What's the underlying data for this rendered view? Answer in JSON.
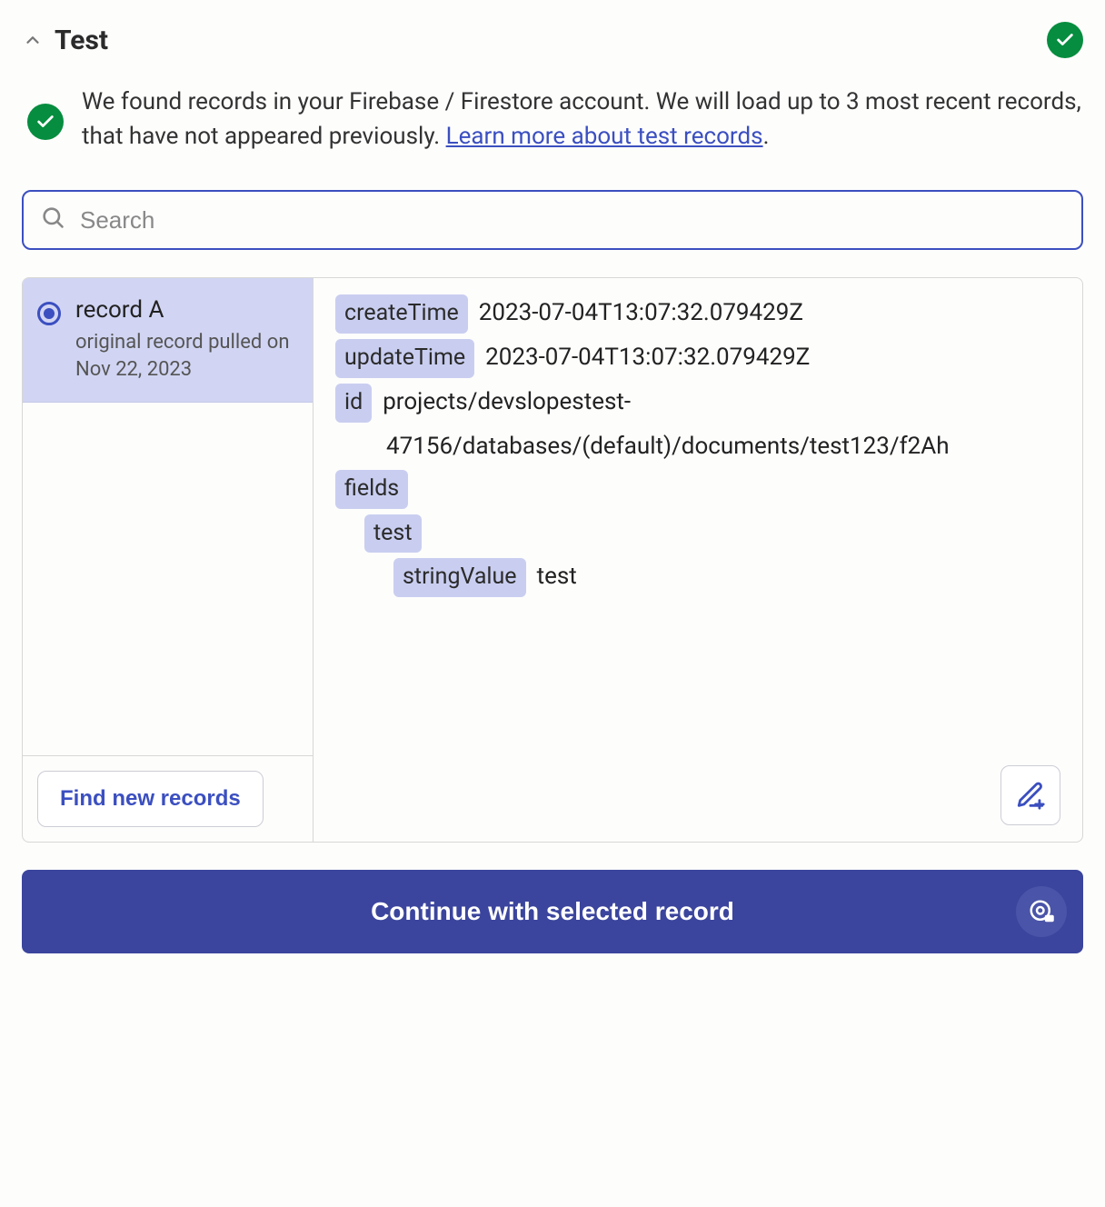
{
  "header": {
    "title": "Test"
  },
  "message": {
    "text_before_link": "We found records in your Firebase / Firestore account. We will load up to 3 most recent records, that have not appeared previously. ",
    "link_text": "Learn more about test records",
    "text_after_link": "."
  },
  "search": {
    "placeholder": "Search"
  },
  "records": [
    {
      "label": "record A",
      "subtitle": "original record pulled on Nov 22, 2023",
      "selected": true
    }
  ],
  "actions": {
    "find_new": "Find new records",
    "continue": "Continue with selected record"
  },
  "detail": {
    "createTime": {
      "key": "createTime",
      "value": "2023-07-04T13:07:32.079429Z"
    },
    "updateTime": {
      "key": "updateTime",
      "value": "2023-07-04T13:07:32.079429Z"
    },
    "id": {
      "key": "id",
      "value_line1": "projects/devslopestest-",
      "value_line2": "47156/databases/(default)/documents/test123/f2Ah"
    },
    "fields": {
      "key": "fields"
    },
    "test": {
      "key": "test"
    },
    "stringValue": {
      "key": "stringValue",
      "value": "test"
    }
  }
}
